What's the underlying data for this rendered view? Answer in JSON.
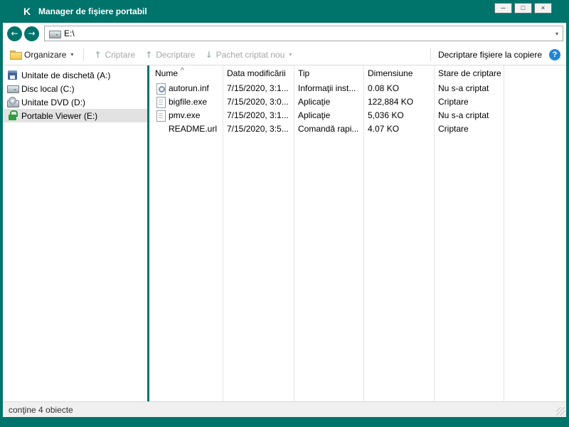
{
  "colors": {
    "accent": "#00736b",
    "help_blue": "#2086d6",
    "disabled_text": "#a6a6a6",
    "selected_row_bg": "#e2e2e2"
  },
  "window": {
    "title": "Manager de fişiere portabil",
    "logo_glyph": "K",
    "minimize_glyph": "─",
    "maximize_glyph": "□",
    "close_glyph": "×"
  },
  "nav": {
    "back_glyph": "←",
    "forward_glyph": "→",
    "address": "E:\\",
    "address_icon": "hdd",
    "dropdown_glyph": "▾"
  },
  "toolbar": {
    "organize_label": "Organizare",
    "organize_icon": "folder",
    "organize_dropdown_glyph": "▾",
    "encrypt_label": "Criptare",
    "encrypt_icon_glyph": "↑",
    "decrypt_label": "Decriptare",
    "decrypt_icon_glyph": "↑",
    "new_package_label": "Pachet criptat nou",
    "new_package_icon_glyph": "↓",
    "new_package_dropdown_glyph": "▾",
    "decrypt_on_copy_label": "Decriptare fişiere la copiere",
    "help_glyph": "?"
  },
  "sidebar": {
    "items": [
      {
        "label": "Unitate de dischetă (A:)",
        "icon": "floppy",
        "selected": false
      },
      {
        "label": "Disc local (C:)",
        "icon": "hdd",
        "selected": false
      },
      {
        "label": "Unitate DVD (D:)",
        "icon": "dvd",
        "selected": false
      },
      {
        "label": "Portable Viewer (E:)",
        "icon": "lock",
        "selected": true
      }
    ]
  },
  "file_list": {
    "sort_indicator_glyph": "^",
    "columns": [
      "Nume",
      "Data modificării",
      "Tip",
      "Dimensiune",
      "Stare de criptare"
    ],
    "rows": [
      {
        "icon": "autorun",
        "name": "autorun.inf",
        "modified": "7/15/2020, 3:1...",
        "type": "Informaţii inst...",
        "size": "0.08 KO",
        "status": "Nu s-a criptat"
      },
      {
        "icon": "doc",
        "name": "bigfile.exe",
        "modified": "7/15/2020, 3:0...",
        "type": "Aplicaţie",
        "size": "122,884 KO",
        "status": "Criptare"
      },
      {
        "icon": "doc",
        "name": "pmv.exe",
        "modified": "7/15/2020, 3:1...",
        "type": "Aplicaţie",
        "size": "5,036 KO",
        "status": "Nu s-a criptat"
      },
      {
        "icon": "none",
        "name": "README.url",
        "modified": "7/15/2020, 3:5...",
        "type": "Comandă rapi...",
        "size": "4.07 KO",
        "status": "Criptare"
      }
    ]
  },
  "status_bar": {
    "text": "conţine 4 obiecte"
  }
}
